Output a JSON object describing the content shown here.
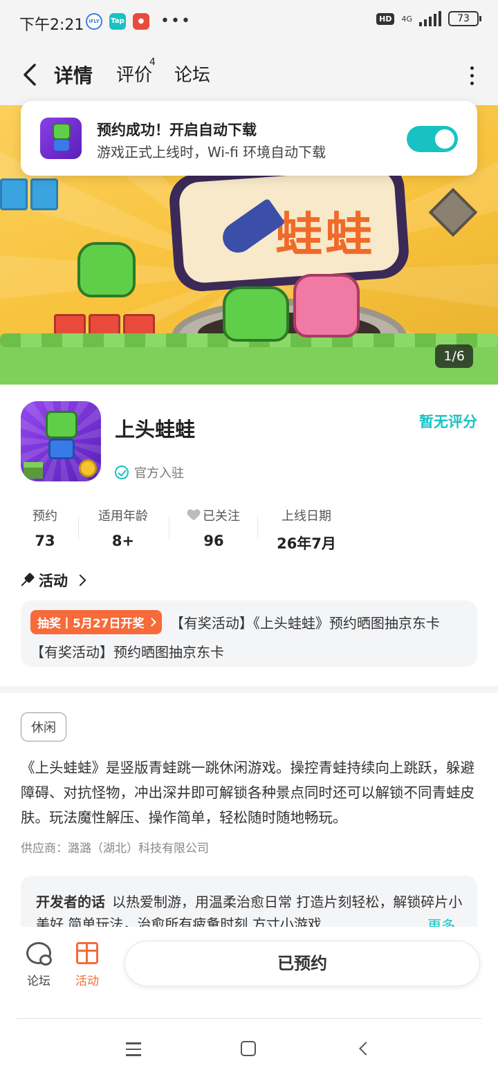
{
  "status_bar": {
    "time": "下午2:21",
    "hd": "HD",
    "network": "4G",
    "battery": "73"
  },
  "header": {
    "tabs": [
      {
        "label": "详情",
        "active": true
      },
      {
        "label": "评价",
        "badge": "4"
      },
      {
        "label": "论坛"
      }
    ]
  },
  "toast": {
    "title": "预约成功！开启自动下载",
    "subtitle": "游戏正式上线时，Wi-fi 环境自动下载",
    "toggle_on": true
  },
  "banner": {
    "title_art": "蛙蛙",
    "page_indicator": "1/6"
  },
  "app": {
    "name": "上头蛙蛙",
    "verified_label": "官方入驻",
    "rating_label": "暂无评分"
  },
  "stats": [
    {
      "label": "预约",
      "value": "73"
    },
    {
      "label": "适用年龄",
      "value": "8+"
    },
    {
      "label": "已关注",
      "value": "96",
      "icon": "heart-icon"
    },
    {
      "label": "上线日期",
      "value": "26年7月"
    }
  ],
  "activity": {
    "heading": "活动",
    "tag": "抽奖丨5月27日开奖",
    "title": "【有奖活动】《上头蛙蛙》预约晒图抽京东卡",
    "subtitle": "【有奖活动】预约晒图抽京东卡"
  },
  "details": {
    "genre": "休闲",
    "description": "《上头蛙蛙》是竖版青蛙跳一跳休闲游戏。操控青蛙持续向上跳跃，躲避障碍、对抗怪物，冲出深井即可解锁各种景点同时还可以解锁不同青蛙皮肤。玩法魔性解压、操作简单，轻松随时随地畅玩。",
    "supplier": "供应商：潞潞（湖北）科技有限公司"
  },
  "developer_note": {
    "label": "开发者的话",
    "text": "以热爱制游，用温柔治愈日常 打造片刻轻松，解锁碎片小美好 简单玩法，治愈所有疲惫时刻 方寸小游戏",
    "more": "更多"
  },
  "bottom_bar": {
    "forum_label": "论坛",
    "activity_label": "活动",
    "reserve_button": "已预约"
  },
  "colors": {
    "accent": "#19c2c2",
    "activity_orange": "#f76a3a"
  }
}
